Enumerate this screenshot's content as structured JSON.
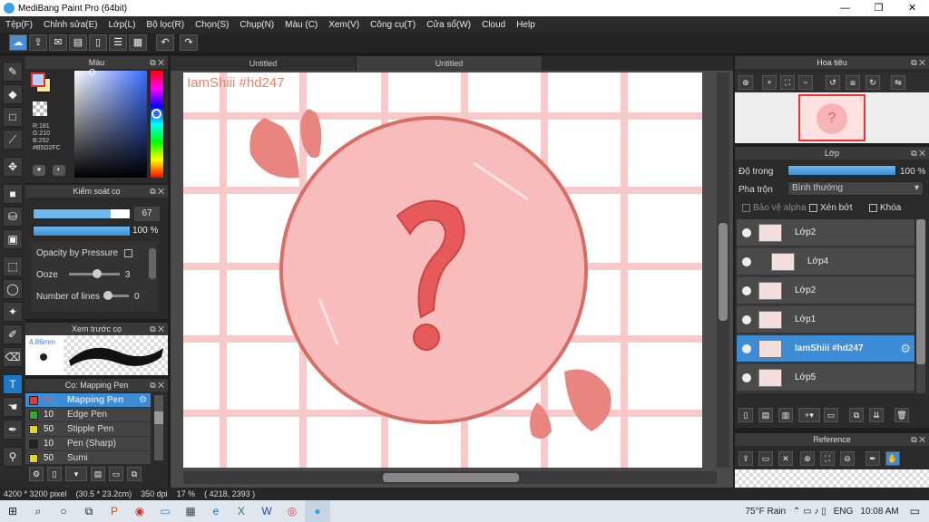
{
  "window": {
    "title": "MediBang Paint Pro (64bit)",
    "minimize": "—",
    "maximize": "❐",
    "close": "✕"
  },
  "menu": [
    "Tệp(F)",
    "Chỉnh sửa(E)",
    "Lớp(L)",
    "Bộ lọc(R)",
    "Chọn(S)",
    "Chụp(N)",
    "Màu (C)",
    "Xem(V)",
    "Công cụ(T)",
    "Cửa sổ(W)",
    "Cloud",
    "Help"
  ],
  "tabs": [
    "Untitled",
    "Untitled"
  ],
  "color_panel": {
    "title": "Màu",
    "rgb": {
      "r": "R:181",
      "g": "G:210",
      "b": "B:252",
      "hex": "#B5D2FC"
    },
    "fg": "#B5D2FC",
    "bg": "#F7E6A0"
  },
  "brush_control": {
    "title": "Kiểm soát cọ",
    "size_value": "67",
    "opacity_value": "100 %",
    "opacity_pressure": "Opacity by Pressure",
    "ooze_label": "Ooze",
    "ooze_value": "3",
    "lines_label": "Number of lines",
    "lines_value": "0"
  },
  "brush_preview": {
    "title": "Xem trước cọ",
    "size": "4.86mm"
  },
  "brush_list": {
    "title": "Cọ: Mapping Pen",
    "items": [
      {
        "size": "67",
        "name": "Mapping Pen",
        "color": "#e23b3b"
      },
      {
        "size": "10",
        "name": "Edge Pen",
        "color": "#2ea82e"
      },
      {
        "size": "50",
        "name": "Stipple Pen",
        "color": "#e8d22a"
      },
      {
        "size": "10",
        "name": "Pen (Sharp)",
        "color": "#222222"
      },
      {
        "size": "50",
        "name": "Sumi",
        "color": "#e8d22a"
      }
    ]
  },
  "canvas": {
    "watermark": "IamShiii #hd247",
    "question": "?"
  },
  "navigator": {
    "title": "Hoa tiêu"
  },
  "layer_panel": {
    "title": "Lớp",
    "opacity_label": "Độ trong",
    "opacity_value": "100 %",
    "blend_label": "Pha trộn",
    "blend_value": "Bình thường",
    "protect_alpha": "Bảo vệ alpha",
    "clipping": "Xén bớt",
    "lock": "Khóa",
    "layers": [
      "Lớp2",
      "Lớp4",
      "Lớp2",
      "Lớp1",
      "IamShiii #hd247",
      "Lớp5"
    ]
  },
  "reference": {
    "title": "Reference"
  },
  "status": {
    "size": "4200 * 3200 pixel",
    "dims": "(30.5 * 23.2cm)",
    "dpi": "350 dpi",
    "zoom": "17 %",
    "coords": "( 4218, 2393 )"
  },
  "taskbar": {
    "weather": "75°F  Rain",
    "lang": "ENG",
    "time": "10:08 AM"
  }
}
